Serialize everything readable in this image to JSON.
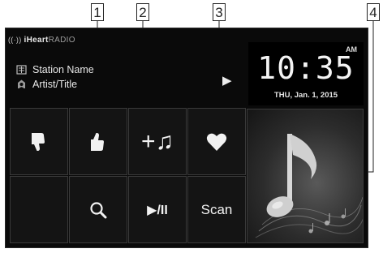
{
  "callouts": [
    "1",
    "2",
    "3",
    "4"
  ],
  "screen": {
    "brand": {
      "bold": "iHeart",
      "regular": "RADIO",
      "icon": "radio-wave-icon"
    },
    "station_name": "Station Name",
    "artist_title": "Artist/Title",
    "station_icon": "station-icon",
    "artist_icon": "artist-icon",
    "play_indicator": "▶",
    "clock": {
      "ampm": "AM",
      "time": "10:35",
      "date": "THU, Jan. 1, 2015"
    },
    "buttons": {
      "thumb_down": {
        "icon": "thumb-down-icon"
      },
      "thumb_up": {
        "icon": "thumb-up-icon"
      },
      "add_song": {
        "label": "+♫",
        "icon": "add-music-icon"
      },
      "favorite": {
        "icon": "heart-icon"
      },
      "blank": {},
      "search": {
        "icon": "search-icon"
      },
      "play_pause": {
        "label": "▶/II",
        "icon": "play-pause-icon"
      },
      "scan": {
        "label": "Scan"
      }
    },
    "album_art": {
      "icon": "music-note-artwork"
    }
  }
}
